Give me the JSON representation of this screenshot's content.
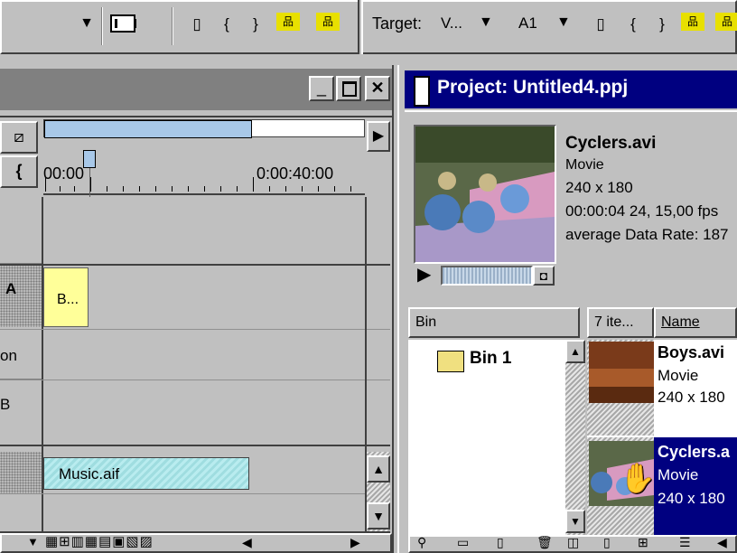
{
  "toolbar": {
    "target_label": "Target:",
    "video_target_value": "V...",
    "audio_target_value": "A1"
  },
  "timeline": {
    "timecode_start": "00:00",
    "timecode_mark": "0:00:40:00",
    "track_labels": {
      "a": "A",
      "on": "on",
      "b": "B"
    },
    "clip_video": "B...",
    "clip_audio": "Music.aif"
  },
  "project": {
    "title": "Project: Untitled4.ppj",
    "preview": {
      "name": "Cyclers.avi",
      "type": "Movie",
      "dimensions": "240 x 180",
      "duration": "00:00:04 24, 15,00 fps",
      "data_rate": "average Data Rate: 187"
    },
    "bin_header": "Bin",
    "items_header": "7 ite...",
    "name_header": "Name",
    "bins": [
      "Bin 1"
    ],
    "items": [
      {
        "name": "Boys.avi",
        "type": "Movie",
        "dimensions": "240 x 180"
      },
      {
        "name": "Cyclers.a",
        "type": "Movie",
        "dimensions": "240 x 180"
      }
    ]
  },
  "colors": {
    "title_bar": "#000080",
    "selection": "#000080",
    "work_area": "#a8c8e8",
    "video_clip": "#ffff99",
    "audio_clip": "#9fdde0"
  }
}
